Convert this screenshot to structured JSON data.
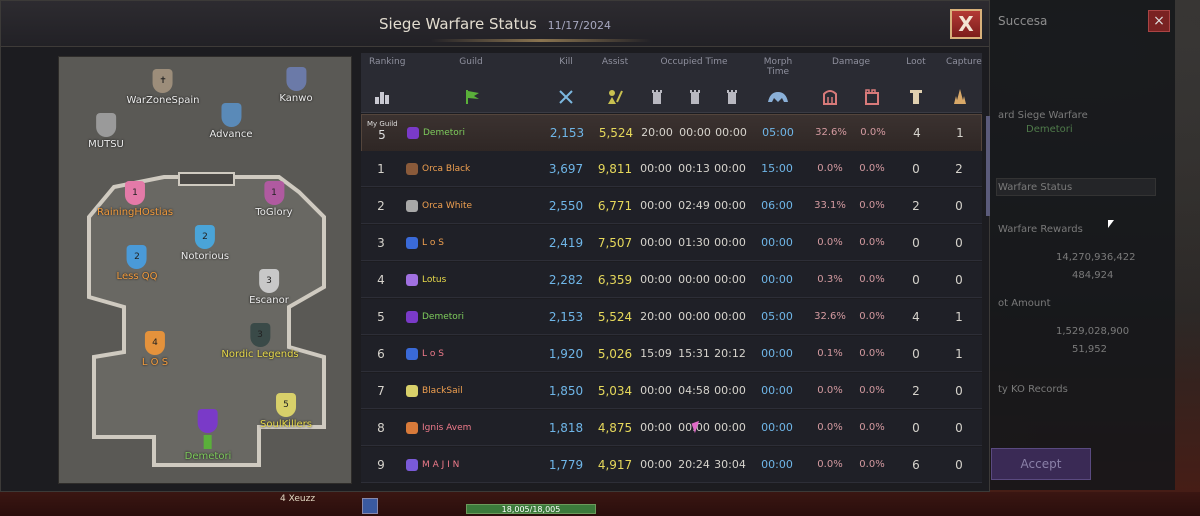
{
  "window": {
    "title": "Siege Warfare Status",
    "date": "11/17/2024",
    "close_label": "X"
  },
  "background_panel": {
    "title": "Succesa",
    "lines": [
      "ard Siege Warfare",
      "Demetori",
      "Warfare Status",
      "Warfare Rewards",
      "14,270,936,422",
      "484,924",
      "ot Amount",
      "1,529,028,900",
      "51,952",
      "ty KO Records",
      "Accept"
    ]
  },
  "map": {
    "guilds": [
      {
        "name": "WarZoneSpain",
        "color": "white",
        "badge": ""
      },
      {
        "name": "Kanwo",
        "color": "white",
        "badge": ""
      },
      {
        "name": "MUTSU",
        "color": "white",
        "badge": ""
      },
      {
        "name": "Advance",
        "color": "white",
        "badge": ""
      },
      {
        "name": "RainingHOstias",
        "color": "orange",
        "badge": "1"
      },
      {
        "name": "ToGlory",
        "color": "white",
        "badge": "1"
      },
      {
        "name": "Notorious",
        "color": "white",
        "badge": "2"
      },
      {
        "name": "Less QQ",
        "color": "orange",
        "badge": "2"
      },
      {
        "name": "Escanor",
        "color": "white",
        "badge": "3"
      },
      {
        "name": "L O S",
        "color": "orange",
        "badge": "4"
      },
      {
        "name": "Nordic Legends",
        "color": "yellow",
        "badge": "3"
      },
      {
        "name": "Demetori",
        "color": "green",
        "badge": ""
      },
      {
        "name": "SoulKillers",
        "color": "yellow",
        "badge": "5"
      }
    ]
  },
  "table": {
    "headers": {
      "ranking": "Ranking",
      "guild": "Guild",
      "kill": "Kill",
      "assist": "Assist",
      "occupied_time": "Occupied Time",
      "morph_time": "Morph Time",
      "damage": "Damage",
      "loot": "Loot",
      "capture": "Capture"
    },
    "my_guild": {
      "label": "My Guild",
      "rank": "5",
      "guild": "Demetori",
      "kill": "2,153",
      "assist": "5,524",
      "t1": "20:00",
      "t2": "00:00",
      "t3": "00:00",
      "morph": "05:00",
      "d1": "32.6%",
      "d2": "0.0%",
      "loot": "4",
      "capture": "1"
    },
    "rows": [
      {
        "rank": "1",
        "guild": "Orca Black",
        "kill": "3,697",
        "assist": "9,811",
        "t1": "00:00",
        "t2": "00:13",
        "t3": "00:00",
        "morph": "15:00",
        "d1": "0.0%",
        "d2": "0.0%",
        "loot": "0",
        "capture": "2"
      },
      {
        "rank": "2",
        "guild": "Orca White",
        "kill": "2,550",
        "assist": "6,771",
        "t1": "00:00",
        "t2": "02:49",
        "t3": "00:00",
        "morph": "06:00",
        "d1": "33.1%",
        "d2": "0.0%",
        "loot": "2",
        "capture": "0"
      },
      {
        "rank": "3",
        "guild": "L o S",
        "kill": "2,419",
        "assist": "7,507",
        "t1": "00:00",
        "t2": "01:30",
        "t3": "00:00",
        "morph": "00:00",
        "d1": "0.0%",
        "d2": "0.0%",
        "loot": "0",
        "capture": "0"
      },
      {
        "rank": "4",
        "guild": "Lotus",
        "kill": "2,282",
        "assist": "6,359",
        "t1": "00:00",
        "t2": "00:00",
        "t3": "00:00",
        "morph": "00:00",
        "d1": "0.3%",
        "d2": "0.0%",
        "loot": "0",
        "capture": "0"
      },
      {
        "rank": "5",
        "guild": "Demetori",
        "kill": "2,153",
        "assist": "5,524",
        "t1": "20:00",
        "t2": "00:00",
        "t3": "00:00",
        "morph": "05:00",
        "d1": "32.6%",
        "d2": "0.0%",
        "loot": "4",
        "capture": "1"
      },
      {
        "rank": "6",
        "guild": "L o S",
        "kill": "1,920",
        "assist": "5,026",
        "t1": "15:09",
        "t2": "15:31",
        "t3": "20:12",
        "morph": "00:00",
        "d1": "0.1%",
        "d2": "0.0%",
        "loot": "0",
        "capture": "1"
      },
      {
        "rank": "7",
        "guild": "BlackSail",
        "kill": "1,850",
        "assist": "5,034",
        "t1": "00:00",
        "t2": "04:58",
        "t3": "00:00",
        "morph": "00:00",
        "d1": "0.0%",
        "d2": "0.0%",
        "loot": "2",
        "capture": "0"
      },
      {
        "rank": "8",
        "guild": "Ignis Avem",
        "kill": "1,818",
        "assist": "4,875",
        "t1": "00:00",
        "t2": "00:00",
        "t3": "00:00",
        "morph": "00:00",
        "d1": "0.0%",
        "d2": "0.0%",
        "loot": "0",
        "capture": "0"
      },
      {
        "rank": "9",
        "guild": "M A J I N",
        "kill": "1,779",
        "assist": "4,917",
        "t1": "00:00",
        "t2": "20:24",
        "t3": "30:04",
        "morph": "00:00",
        "d1": "0.0%",
        "d2": "0.0%",
        "loot": "6",
        "capture": "0"
      }
    ]
  },
  "hud": {
    "player_name": "4 Xeuzz",
    "hp_text": "18,005/18,005"
  }
}
